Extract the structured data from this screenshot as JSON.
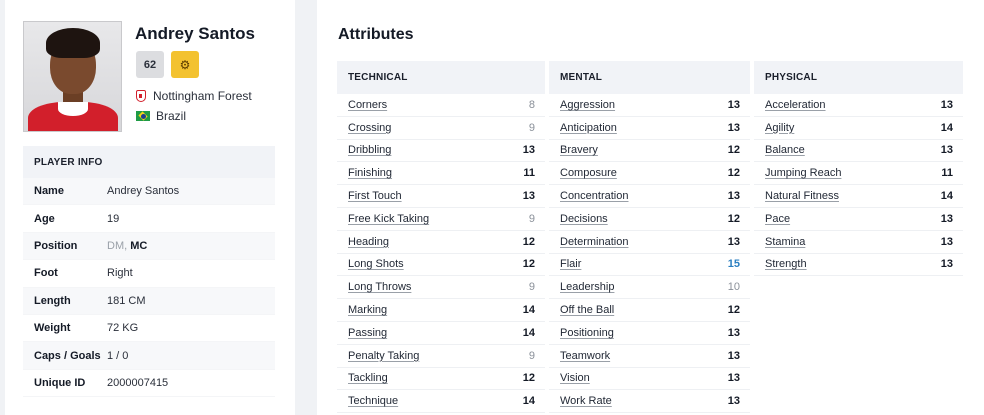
{
  "profile": {
    "name": "Andrey Santos",
    "rating": "62",
    "gear_icon": "gear-icon",
    "club": "Nottingham Forest",
    "nationality": "Brazil",
    "club_icon": "club-crest-icon",
    "flag_icon": "brazil-flag-icon"
  },
  "player_info": {
    "header": "PLAYER INFO",
    "name_label": "Name",
    "name_value": "Andrey Santos",
    "age_label": "Age",
    "age_value": "19",
    "position_label": "Position",
    "position_secondary": "DM, ",
    "position_primary": "MC",
    "foot_label": "Foot",
    "foot_value": "Right",
    "length_label": "Length",
    "length_value": "181 CM",
    "weight_label": "Weight",
    "weight_value": "72 KG",
    "caps_label": "Caps / Goals",
    "caps_value": "1 / 0",
    "uid_label": "Unique ID",
    "uid_value": "2000007415"
  },
  "attributes": {
    "title": "Attributes",
    "colors": {
      "highlight": "#2b7fc1",
      "dim": "#8a9099"
    },
    "technical": {
      "header": "TECHNICAL",
      "items": [
        {
          "name": "Corners",
          "value": "8"
        },
        {
          "name": "Crossing",
          "value": "9"
        },
        {
          "name": "Dribbling",
          "value": "13"
        },
        {
          "name": "Finishing",
          "value": "11"
        },
        {
          "name": "First Touch",
          "value": "13"
        },
        {
          "name": "Free Kick Taking",
          "value": "9"
        },
        {
          "name": "Heading",
          "value": "12"
        },
        {
          "name": "Long Shots",
          "value": "12"
        },
        {
          "name": "Long Throws",
          "value": "9"
        },
        {
          "name": "Marking",
          "value": "14"
        },
        {
          "name": "Passing",
          "value": "14"
        },
        {
          "name": "Penalty Taking",
          "value": "9"
        },
        {
          "name": "Tackling",
          "value": "12"
        },
        {
          "name": "Technique",
          "value": "14"
        }
      ]
    },
    "mental": {
      "header": "MENTAL",
      "items": [
        {
          "name": "Aggression",
          "value": "13"
        },
        {
          "name": "Anticipation",
          "value": "13"
        },
        {
          "name": "Bravery",
          "value": "12"
        },
        {
          "name": "Composure",
          "value": "12"
        },
        {
          "name": "Concentration",
          "value": "13"
        },
        {
          "name": "Decisions",
          "value": "12"
        },
        {
          "name": "Determination",
          "value": "13"
        },
        {
          "name": "Flair",
          "value": "15"
        },
        {
          "name": "Leadership",
          "value": "10"
        },
        {
          "name": "Off the Ball",
          "value": "12"
        },
        {
          "name": "Positioning",
          "value": "13"
        },
        {
          "name": "Teamwork",
          "value": "13"
        },
        {
          "name": "Vision",
          "value": "13"
        },
        {
          "name": "Work Rate",
          "value": "13"
        }
      ]
    },
    "physical": {
      "header": "PHYSICAL",
      "items": [
        {
          "name": "Acceleration",
          "value": "13"
        },
        {
          "name": "Agility",
          "value": "14"
        },
        {
          "name": "Balance",
          "value": "13"
        },
        {
          "name": "Jumping Reach",
          "value": "11"
        },
        {
          "name": "Natural Fitness",
          "value": "14"
        },
        {
          "name": "Pace",
          "value": "13"
        },
        {
          "name": "Stamina",
          "value": "13"
        },
        {
          "name": "Strength",
          "value": "13"
        }
      ]
    }
  }
}
